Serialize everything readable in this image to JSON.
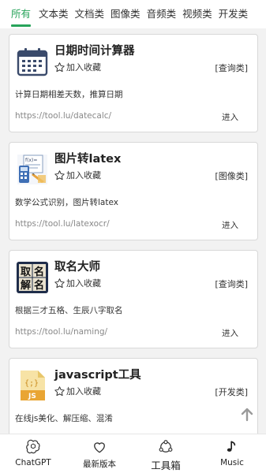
{
  "tabs": [
    "所有",
    "文本类",
    "文档类",
    "图像类",
    "音频类",
    "视频类",
    "开发类"
  ],
  "active_tab": 0,
  "cards": [
    {
      "title": "日期时间计算器",
      "fav_label": "加入收藏",
      "category": "[查询类]",
      "desc": "计算日期相差天数，推算日期",
      "url": "https://tool.lu/datecalc/",
      "enter_label": "进入",
      "icon": "calendar-icon"
    },
    {
      "title": "图片转latex",
      "fav_label": "加入收藏",
      "category": "[图像类]",
      "desc": "数学公式识别，图片转latex",
      "url": "https://tool.lu/latexocr/",
      "enter_label": "进入",
      "icon": "formula-image-icon"
    },
    {
      "title": "取名大师",
      "fav_label": "加入收藏",
      "category": "[查询类]",
      "desc": "根据三才五格、生辰八字取名",
      "url": "https://tool.lu/naming/",
      "enter_label": "进入",
      "icon": "naming-icon",
      "icon_chars": [
        "取",
        "名",
        "解",
        "名"
      ]
    },
    {
      "title": "javascript工具",
      "fav_label": "加入收藏",
      "category": "[开发类]",
      "desc": "在线js美化、解压缩、混淆",
      "url": "",
      "enter_label": "",
      "icon": "js-file-icon",
      "icon_text": "JS",
      "icon_brace": "{;}"
    }
  ],
  "nav": [
    {
      "label": "ChatGPT",
      "icon": "chatgpt-icon"
    },
    {
      "label": "最新版本",
      "icon": "heart-icon"
    },
    {
      "label": "工具箱",
      "icon": "toolbox-icon"
    },
    {
      "label": "Music",
      "icon": "music-note-icon"
    }
  ],
  "colors": {
    "accent": "#27a35a",
    "card_border": "#d8d8d8",
    "background": "#f2f2f2"
  }
}
